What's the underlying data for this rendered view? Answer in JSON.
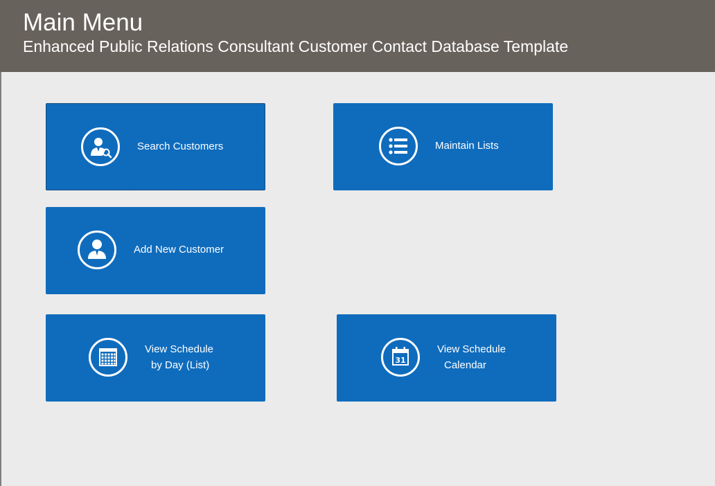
{
  "header": {
    "title": "Main Menu",
    "subtitle": "Enhanced Public Relations Consultant Customer Contact Database Template"
  },
  "buttons": {
    "search_customers": {
      "label": "Search Customers",
      "icon": "search-person-icon"
    },
    "maintain_lists": {
      "label": "Maintain Lists",
      "icon": "list-icon"
    },
    "add_new_customer": {
      "label": "Add New Customer",
      "icon": "person-icon"
    },
    "view_schedule_day": {
      "line1": "View Schedule",
      "line2": "by Day (List)",
      "icon": "calendar-grid-icon"
    },
    "view_schedule_calendar": {
      "line1": "View Schedule",
      "line2": "Calendar",
      "icon": "calendar-31-icon"
    },
    "calendar_day_number": "31"
  },
  "colors": {
    "header_bg": "#68625c",
    "page_bg": "#ebebeb",
    "tile_bg": "#0f6cbd",
    "text": "#ffffff"
  }
}
